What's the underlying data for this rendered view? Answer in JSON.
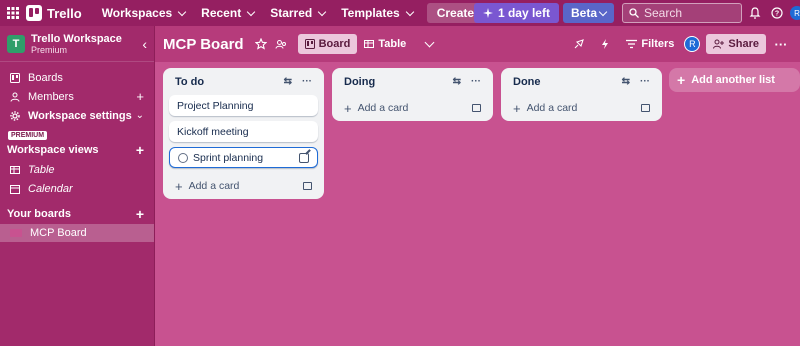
{
  "topbar": {
    "app_name": "Trello",
    "nav": [
      {
        "label": "Workspaces"
      },
      {
        "label": "Recent"
      },
      {
        "label": "Starred"
      },
      {
        "label": "Templates"
      }
    ],
    "create_label": "Create",
    "trial_label": "1 day left",
    "beta_label": "Beta",
    "search_placeholder": "Search",
    "right_avatar": "R"
  },
  "sidebar": {
    "workspace_initial": "T",
    "workspace_name": "Trello Workspace",
    "workspace_plan": "Premium",
    "items": [
      {
        "label": "Boards"
      },
      {
        "label": "Members"
      },
      {
        "label": "Workspace settings"
      }
    ],
    "premium_badge": "PREMIUM",
    "views_title": "Workspace views",
    "views": [
      {
        "label": "Table"
      },
      {
        "label": "Calendar"
      }
    ],
    "boards_title": "Your boards",
    "boards": [
      {
        "label": "MCP Board"
      }
    ]
  },
  "board": {
    "title": "MCP Board",
    "view_board": "Board",
    "view_table": "Table",
    "filters_label": "Filters",
    "member_initial": "R",
    "share_label": "Share"
  },
  "lists": [
    {
      "title": "To do",
      "cards": [
        "Project Planning",
        "Kickoff meeting",
        "Sprint planning"
      ],
      "add_label": "Add a card"
    },
    {
      "title": "Doing",
      "cards": [],
      "add_label": "Add a card"
    },
    {
      "title": "Done",
      "cards": [],
      "add_label": "Add a card"
    }
  ],
  "add_list_label": "Add another list",
  "colors": {
    "topbar": "#951f61",
    "sidebar": "#a22a6b",
    "board_bg": "#c85290",
    "list_bg": "#f1f2f4",
    "accent_blue": "#1f6bd6"
  }
}
